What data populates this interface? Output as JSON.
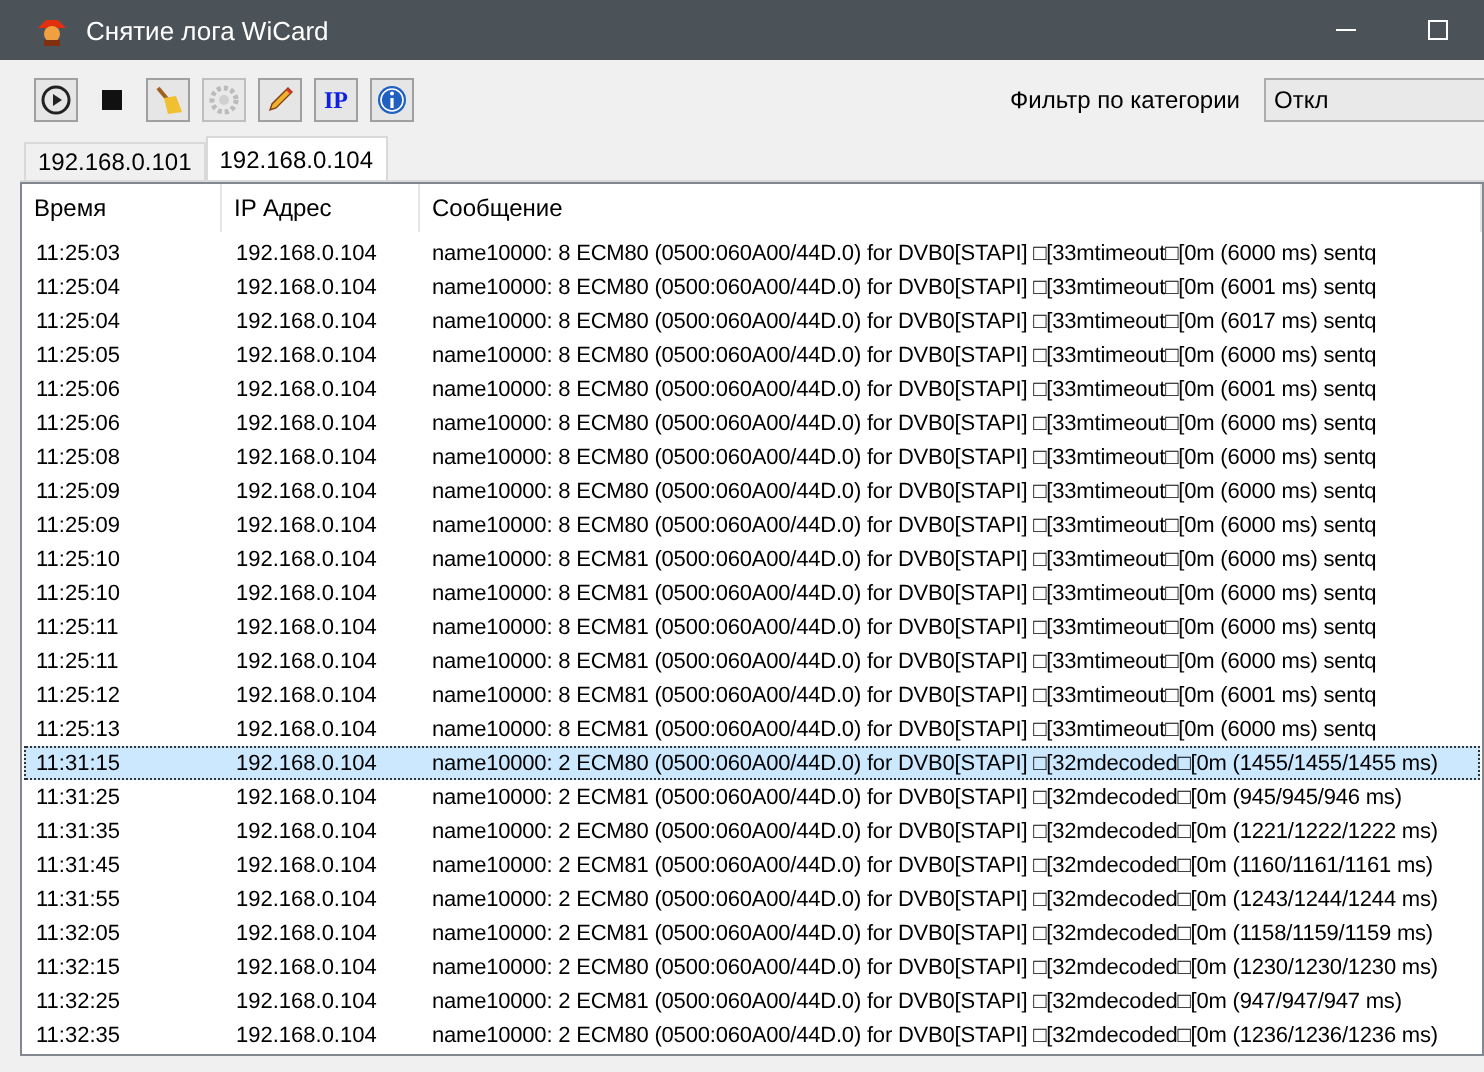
{
  "window": {
    "title": "Снятие лога WiCard"
  },
  "toolbar": {
    "buttons": [
      {
        "kind": "play",
        "disabled": false
      },
      {
        "kind": "stop",
        "disabled": false
      },
      {
        "kind": "broom",
        "disabled": false
      },
      {
        "kind": "gear",
        "disabled": true
      },
      {
        "kind": "pencil",
        "disabled": false
      },
      {
        "kind": "ip",
        "label": "IP",
        "disabled": false
      },
      {
        "kind": "info",
        "disabled": false
      }
    ]
  },
  "filter": {
    "label": "Фильтр по категории",
    "value": "Откл"
  },
  "tabs": [
    {
      "label": "192.168.0.101",
      "selected": false
    },
    {
      "label": "192.168.0.104",
      "selected": true
    }
  ],
  "table": {
    "columns": [
      "Время",
      "IP Адрес",
      "Сообщение"
    ],
    "rows": [
      {
        "time": "11:25:03",
        "ip": "192.168.0.104",
        "message": "name10000: 8 ECM80 (0500:060A00/44D.0) for DVB0[STAPI] □[33mtimeout□[0m (6000 ms) sentq",
        "selected": false
      },
      {
        "time": "11:25:04",
        "ip": "192.168.0.104",
        "message": "name10000: 8 ECM80 (0500:060A00/44D.0) for DVB0[STAPI] □[33mtimeout□[0m (6001 ms) sentq",
        "selected": false
      },
      {
        "time": "11:25:04",
        "ip": "192.168.0.104",
        "message": "name10000: 8 ECM80 (0500:060A00/44D.0) for DVB0[STAPI] □[33mtimeout□[0m (6017 ms) sentq",
        "selected": false
      },
      {
        "time": "11:25:05",
        "ip": "192.168.0.104",
        "message": "name10000: 8 ECM80 (0500:060A00/44D.0) for DVB0[STAPI] □[33mtimeout□[0m (6000 ms) sentq",
        "selected": false
      },
      {
        "time": "11:25:06",
        "ip": "192.168.0.104",
        "message": "name10000: 8 ECM80 (0500:060A00/44D.0) for DVB0[STAPI] □[33mtimeout□[0m (6001 ms) sentq",
        "selected": false
      },
      {
        "time": "11:25:06",
        "ip": "192.168.0.104",
        "message": "name10000: 8 ECM80 (0500:060A00/44D.0) for DVB0[STAPI] □[33mtimeout□[0m (6000 ms) sentq",
        "selected": false
      },
      {
        "time": "11:25:08",
        "ip": "192.168.0.104",
        "message": "name10000: 8 ECM80 (0500:060A00/44D.0) for DVB0[STAPI] □[33mtimeout□[0m (6000 ms) sentq",
        "selected": false
      },
      {
        "time": "11:25:09",
        "ip": "192.168.0.104",
        "message": "name10000: 8 ECM80 (0500:060A00/44D.0) for DVB0[STAPI] □[33mtimeout□[0m (6000 ms) sentq",
        "selected": false
      },
      {
        "time": "11:25:09",
        "ip": "192.168.0.104",
        "message": "name10000: 8 ECM80 (0500:060A00/44D.0) for DVB0[STAPI] □[33mtimeout□[0m (6000 ms) sentq",
        "selected": false
      },
      {
        "time": "11:25:10",
        "ip": "192.168.0.104",
        "message": "name10000: 8 ECM81 (0500:060A00/44D.0) for DVB0[STAPI] □[33mtimeout□[0m (6000 ms) sentq",
        "selected": false
      },
      {
        "time": "11:25:10",
        "ip": "192.168.0.104",
        "message": "name10000: 8 ECM81 (0500:060A00/44D.0) for DVB0[STAPI] □[33mtimeout□[0m (6000 ms) sentq",
        "selected": false
      },
      {
        "time": "11:25:11",
        "ip": "192.168.0.104",
        "message": "name10000: 8 ECM81 (0500:060A00/44D.0) for DVB0[STAPI] □[33mtimeout□[0m (6000 ms) sentq",
        "selected": false
      },
      {
        "time": "11:25:11",
        "ip": "192.168.0.104",
        "message": "name10000: 8 ECM81 (0500:060A00/44D.0) for DVB0[STAPI] □[33mtimeout□[0m (6000 ms) sentq",
        "selected": false
      },
      {
        "time": "11:25:12",
        "ip": "192.168.0.104",
        "message": "name10000: 8 ECM81 (0500:060A00/44D.0) for DVB0[STAPI] □[33mtimeout□[0m (6001 ms) sentq",
        "selected": false
      },
      {
        "time": "11:25:13",
        "ip": "192.168.0.104",
        "message": "name10000: 8 ECM81 (0500:060A00/44D.0) for DVB0[STAPI] □[33mtimeout□[0m (6000 ms) sentq",
        "selected": false
      },
      {
        "time": "11:31:15",
        "ip": "192.168.0.104",
        "message": "name10000: 2 ECM80 (0500:060A00/44D.0) for DVB0[STAPI] □[32mdecoded□[0m (1455/1455/1455 ms)",
        "selected": true
      },
      {
        "time": "11:31:25",
        "ip": "192.168.0.104",
        "message": "name10000: 2 ECM81 (0500:060A00/44D.0) for DVB0[STAPI] □[32mdecoded□[0m (945/945/946 ms)",
        "selected": false
      },
      {
        "time": "11:31:35",
        "ip": "192.168.0.104",
        "message": "name10000: 2 ECM80 (0500:060A00/44D.0) for DVB0[STAPI] □[32mdecoded□[0m (1221/1222/1222 ms)",
        "selected": false
      },
      {
        "time": "11:31:45",
        "ip": "192.168.0.104",
        "message": "name10000: 2 ECM81 (0500:060A00/44D.0) for DVB0[STAPI] □[32mdecoded□[0m (1160/1161/1161 ms)",
        "selected": false
      },
      {
        "time": "11:31:55",
        "ip": "192.168.0.104",
        "message": "name10000: 2 ECM80 (0500:060A00/44D.0) for DVB0[STAPI] □[32mdecoded□[0m (1243/1244/1244 ms)",
        "selected": false
      },
      {
        "time": "11:32:05",
        "ip": "192.168.0.104",
        "message": "name10000: 2 ECM81 (0500:060A00/44D.0) for DVB0[STAPI] □[32mdecoded□[0m (1158/1159/1159 ms)",
        "selected": false
      },
      {
        "time": "11:32:15",
        "ip": "192.168.0.104",
        "message": "name10000: 2 ECM80 (0500:060A00/44D.0) for DVB0[STAPI] □[32mdecoded□[0m (1230/1230/1230 ms)",
        "selected": false
      },
      {
        "time": "11:32:25",
        "ip": "192.168.0.104",
        "message": "name10000: 2 ECM81 (0500:060A00/44D.0) for DVB0[STAPI] □[32mdecoded□[0m (947/947/947 ms)",
        "selected": false
      },
      {
        "time": "11:32:35",
        "ip": "192.168.0.104",
        "message": "name10000: 2 ECM80 (0500:060A00/44D.0) for DVB0[STAPI] □[32mdecoded□[0m (1236/1236/1236 ms)",
        "selected": false
      }
    ]
  }
}
